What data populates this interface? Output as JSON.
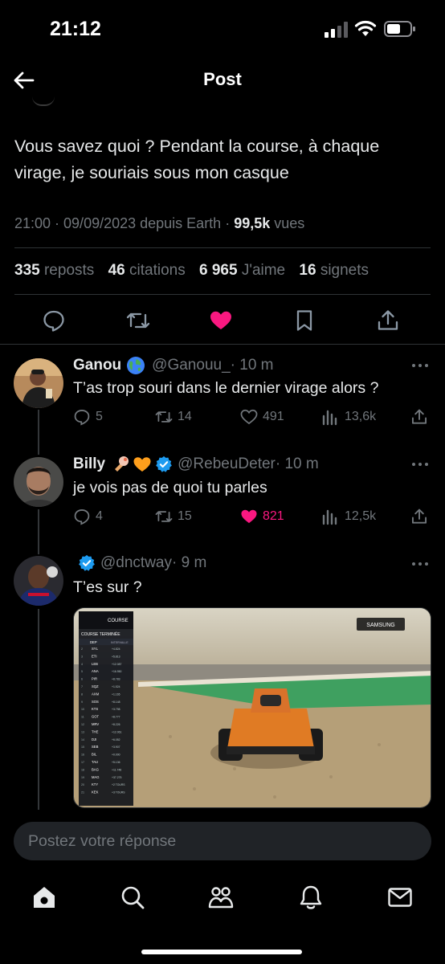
{
  "status_bar": {
    "time": "21:12"
  },
  "header": {
    "title": "Post"
  },
  "post": {
    "text": "Vous savez quoi ? Pendant la course, à chaque virage, je souriais sous mon casque",
    "timestamp": "21:00 · 09/09/2023 depuis Earth · ",
    "views_count": "99,5k",
    "views_label": " vues",
    "stats": {
      "reposts_count": "335",
      "reposts_label": "reposts",
      "quotes_count": "46",
      "quotes_label": "citations",
      "likes_count": "6 965",
      "likes_label": "J'aime",
      "bookmarks_count": "16",
      "bookmarks_label": "signets"
    },
    "actions": [
      "reply-icon",
      "repost-icon",
      "heart-icon",
      "bookmark-icon",
      "share-icon"
    ],
    "like_color": "#f91880"
  },
  "replies": [
    {
      "name": "Ganou",
      "badge": "globe-emoji",
      "handle": "@Ganouu_",
      "time": " · 10 m",
      "text": "T’as trop souri dans le dernier virage alors ?",
      "replies": "5",
      "reposts": "14",
      "likes": "491",
      "views": "13,6k",
      "liked": false
    },
    {
      "name": "Billy",
      "badge": "ice-cream-orange-heart-verified",
      "handle": "@RebeuDeter",
      "time": " · 10 m",
      "text": "je vois pas de quoi tu parles",
      "replies": "4",
      "reposts": "15",
      "likes": "821",
      "views": "12,5k",
      "liked": true
    },
    {
      "name": "",
      "badge": "verified",
      "handle": "@dnctway",
      "time": " · 9 m",
      "text": "T’es sur ?"
    }
  ],
  "media": {
    "overlay_title": "COURSE",
    "overlay_subtitle": "COURSE TERMINÉE",
    "columns": [
      "DEP",
      "INTERVALLE"
    ],
    "brand": "SAMSUNG",
    "leaderboard": [
      {
        "pos": "1",
        "code": "DEP",
        "gap": "INTERVALLE"
      },
      {
        "pos": "2",
        "code": "SYL",
        "gap": "+4.824"
      },
      {
        "pos": "3",
        "code": "ETI",
        "gap": "+5.813"
      },
      {
        "pos": "4",
        "code": "LEB",
        "gap": "+12.087"
      },
      {
        "pos": "5",
        "code": "ANA",
        "gap": "+16.950"
      },
      {
        "pos": "6",
        "code": "PIR",
        "gap": "+8.783"
      },
      {
        "pos": "7",
        "code": "SQZ",
        "gap": "+1.524"
      },
      {
        "pos": "8",
        "code": "AXM",
        "gap": "+1.165"
      },
      {
        "pos": "9",
        "code": "SOS",
        "gap": "+8.148"
      },
      {
        "pos": "10",
        "code": "KTS",
        "gap": "+3.798"
      },
      {
        "pos": "11",
        "code": "GOT",
        "gap": "+8.777"
      },
      {
        "pos": "12",
        "code": "MRV",
        "gap": "+8.226"
      },
      {
        "pos": "13",
        "code": "THE",
        "gap": "+12.061"
      },
      {
        "pos": "14",
        "code": "DJI",
        "gap": "+6.052"
      },
      {
        "pos": "15",
        "code": "SEB",
        "gap": "+3.907"
      },
      {
        "pos": "16",
        "code": "BIL",
        "gap": "+0.000"
      },
      {
        "pos": "17",
        "code": "TAU",
        "gap": "+5.136"
      },
      {
        "pos": "18",
        "code": "BAG",
        "gap": "+11.748"
      },
      {
        "pos": "19",
        "code": "MAG",
        "gap": "+37.275"
      },
      {
        "pos": "20",
        "code": "KTY",
        "gap": "+2 TOURS"
      },
      {
        "pos": "21",
        "code": "KEK",
        "gap": "+3 TOURS"
      }
    ]
  },
  "reply_box": {
    "placeholder": "Postez votre réponse"
  },
  "tabbar": [
    "home-icon",
    "search-icon",
    "communities-icon",
    "notifications-icon",
    "messages-icon"
  ]
}
